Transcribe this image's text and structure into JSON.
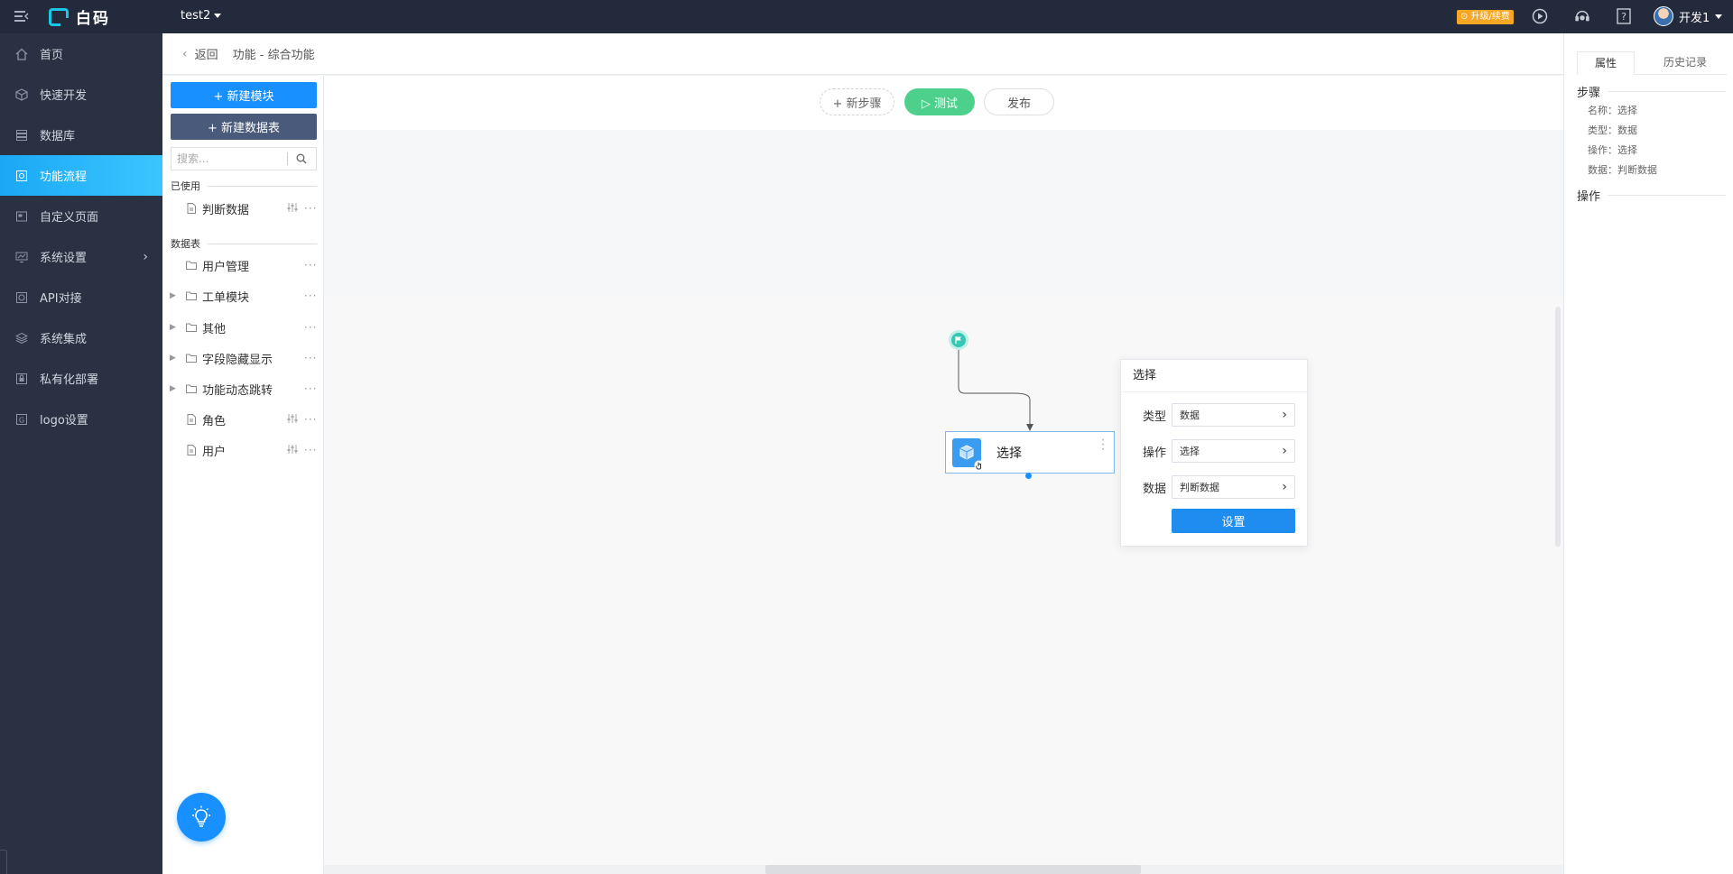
{
  "app": {
    "logo_text": "白码",
    "current_app": "test2",
    "upgrade_badge": "⊙ 升级/续费",
    "user_name": "开发1"
  },
  "sidebar": {
    "items": [
      {
        "label": "首页",
        "icon": "home-icon"
      },
      {
        "label": "快速开发",
        "icon": "cube-icon"
      },
      {
        "label": "数据库",
        "icon": "database-icon"
      },
      {
        "label": "功能流程",
        "icon": "flow-icon",
        "active": true
      },
      {
        "label": "自定义页面",
        "icon": "page-icon"
      },
      {
        "label": "系统设置",
        "icon": "monitor-icon",
        "has_arrow": true
      },
      {
        "label": "API对接",
        "icon": "api-icon"
      },
      {
        "label": "系统集成",
        "icon": "layers-icon"
      },
      {
        "label": "私有化部署",
        "icon": "lock-icon"
      },
      {
        "label": "logo设置",
        "icon": "logo-icon"
      }
    ]
  },
  "breadcrumb": {
    "back_label": "返回",
    "path": "功能 - 综合功能"
  },
  "module_panel": {
    "new_module_label": "+ 新建模块",
    "new_table_label": "+ 新建数据表",
    "search_placeholder": "搜索...",
    "used_section": "已使用",
    "used_items": [
      {
        "label": "判断数据",
        "icon": "document-icon"
      }
    ],
    "table_section": "数据表",
    "table_items": [
      {
        "label": "用户管理",
        "icon": "folder-icon",
        "expandable": false
      },
      {
        "label": "工单模块",
        "icon": "folder-icon",
        "expandable": true
      },
      {
        "label": "其他",
        "icon": "folder-icon",
        "expandable": true
      },
      {
        "label": "字段隐藏显示",
        "icon": "folder-icon",
        "expandable": true
      },
      {
        "label": "功能动态跳转",
        "icon": "folder-icon",
        "expandable": true
      },
      {
        "label": "角色",
        "icon": "document-icon",
        "expandable": false
      },
      {
        "label": "用户",
        "icon": "document-icon",
        "expandable": false
      }
    ]
  },
  "toolbar": {
    "new_step_label": "+ 新步骤",
    "test_label": "▷ 测试",
    "publish_label": "发布"
  },
  "flow": {
    "step_label": "选择",
    "popover": {
      "title": "选择",
      "rows": [
        {
          "label": "类型",
          "value": "数据"
        },
        {
          "label": "操作",
          "value": "选择"
        },
        {
          "label": "数据",
          "value": "判断数据"
        }
      ],
      "settings_label": "设置"
    }
  },
  "props": {
    "tab_attributes": "属性",
    "tab_history": "历史记录",
    "step_section": "步骤",
    "lines": [
      "名称：选择",
      "类型：数据",
      "操作：选择",
      "数据：判断数据"
    ],
    "action_section": "操作"
  },
  "colors": {
    "topbar": "#232a3b",
    "sidebar": "#2a3142",
    "active_nav": "#1aa8f5",
    "primary": "#1890ff",
    "test_green": "#4cd08c",
    "upgrade": "#f5a623"
  }
}
